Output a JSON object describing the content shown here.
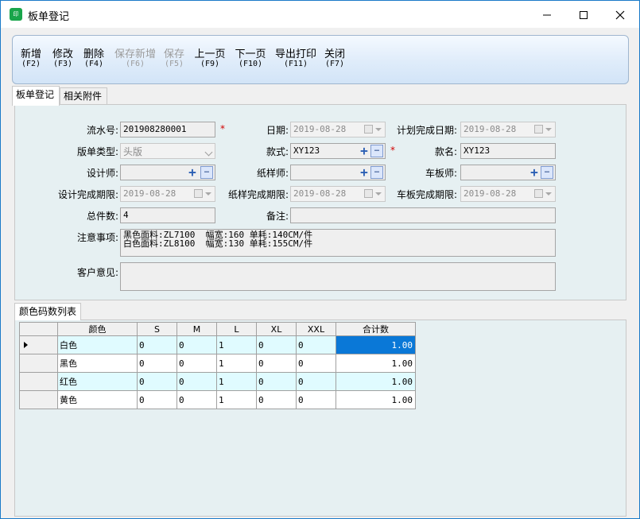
{
  "window": {
    "title": "板单登记",
    "app_icon_text": "印"
  },
  "toolbar": [
    {
      "label": "新增",
      "key": "(F2)",
      "enabled": true
    },
    {
      "label": "修改",
      "key": "(F3)",
      "enabled": true
    },
    {
      "label": "删除",
      "key": "(F4)",
      "enabled": true
    },
    {
      "label": "保存新增",
      "key": "(F6)",
      "enabled": false
    },
    {
      "label": "保存",
      "key": "(F5)",
      "enabled": false
    },
    {
      "label": "上一页",
      "key": "(F9)",
      "enabled": true
    },
    {
      "label": "下一页",
      "key": "(F10)",
      "enabled": true
    },
    {
      "label": "导出打印",
      "key": "(F11)",
      "enabled": true
    },
    {
      "label": "关闭",
      "key": "(F7)",
      "enabled": true
    }
  ],
  "tabs": [
    "板单登记",
    "相关附件"
  ],
  "form": {
    "serial_label": "流水号:",
    "serial_value": "201908280001",
    "date_label": "日期:",
    "date_value": "2019-08-28",
    "plan_done_label": "计划完成日期:",
    "plan_done_value": "2019-08-28",
    "type_label": "版单类型:",
    "type_value": "头版",
    "style_label": "款式:",
    "style_value": "XY123",
    "style_name_label": "款名:",
    "style_name_value": "XY123",
    "designer_label": "设计师:",
    "designer_value": "",
    "pattern_label": "纸样师:",
    "pattern_value": "",
    "sewer_label": "车板师:",
    "sewer_value": "",
    "design_deadline_label": "设计完成期限:",
    "design_deadline_value": "2019-08-28",
    "pattern_deadline_label": "纸样完成期限:",
    "pattern_deadline_value": "2019-08-28",
    "sew_deadline_label": "车板完成期限:",
    "sew_deadline_value": "2019-08-28",
    "total_label": "总件数:",
    "total_value": "4",
    "remark_label": "备注:",
    "remark_value": "",
    "notes_label": "注意事项:",
    "notes_value": "黑色面料:ZL7100  幅宽:160 单耗:140CM/件\n白色面料:ZL8100  幅宽:130 单耗:155CM/件",
    "customer_label": "客户意见:",
    "customer_value": "",
    "required_mark": "*"
  },
  "grid": {
    "tab_label": "颜色码数列表",
    "headers": [
      "颜色",
      "S",
      "M",
      "L",
      "XL",
      "XXL",
      "合计数"
    ],
    "rows": [
      [
        "白色",
        "0",
        "0",
        "1",
        "0",
        "0",
        "1.00"
      ],
      [
        "黑色",
        "0",
        "0",
        "1",
        "0",
        "0",
        "1.00"
      ],
      [
        "红色",
        "0",
        "0",
        "1",
        "0",
        "0",
        "1.00"
      ],
      [
        "黄色",
        "0",
        "0",
        "1",
        "0",
        "0",
        "1.00"
      ]
    ]
  }
}
